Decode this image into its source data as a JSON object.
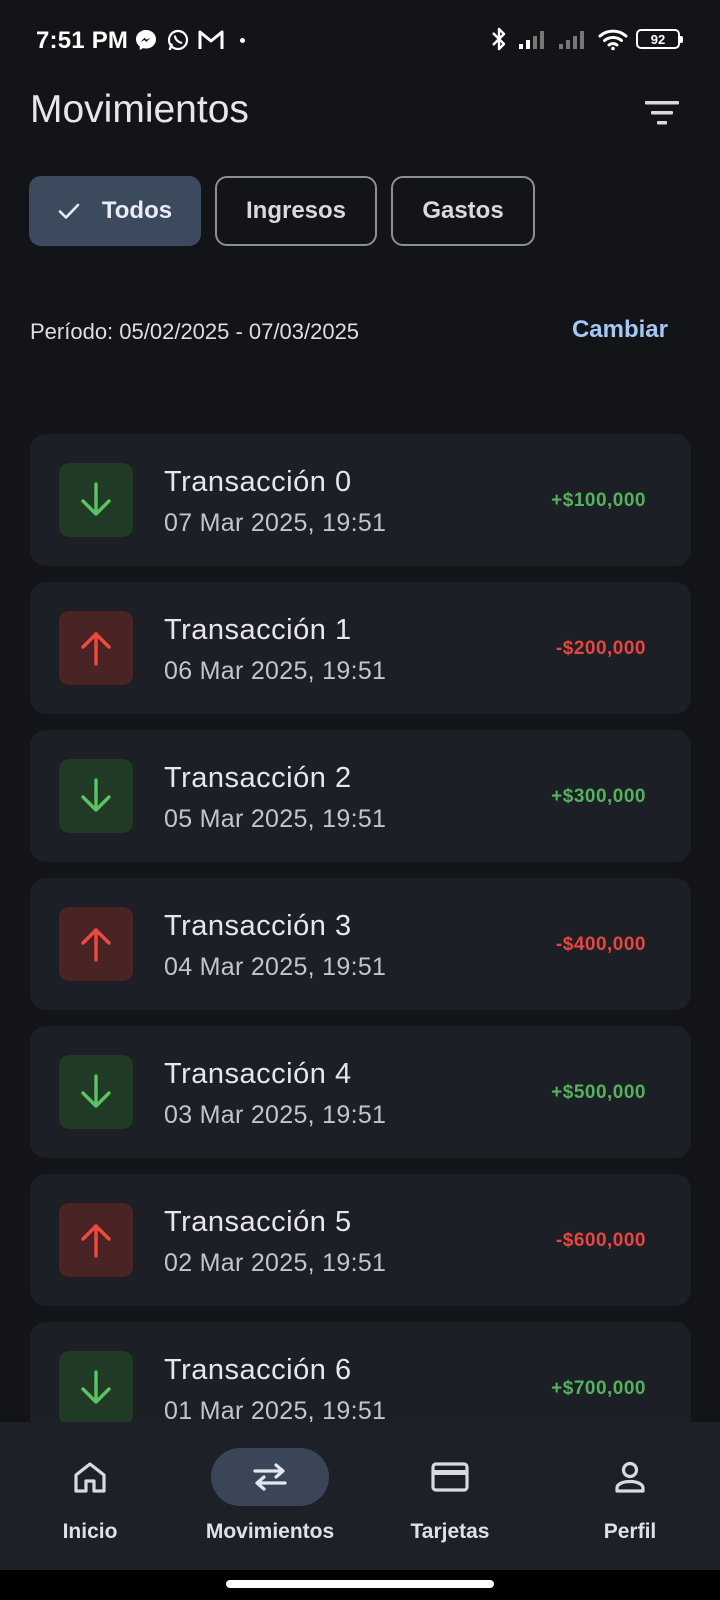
{
  "status_bar": {
    "time": "7:51 PM",
    "battery": "92",
    "icons": [
      "messenger-icon",
      "whatsapp-icon",
      "gmail-icon",
      "bluetooth-icon",
      "signal-icon",
      "wifi-icon",
      "battery-icon"
    ]
  },
  "header": {
    "title": "Movimientos",
    "filter_icon": "filter-icon"
  },
  "chips": [
    {
      "label": "Todos",
      "selected": true
    },
    {
      "label": "Ingresos",
      "selected": false
    },
    {
      "label": "Gastos",
      "selected": false
    }
  ],
  "period": {
    "text": "Período: 05/02/2025 - 07/03/2025",
    "change_label": "Cambiar"
  },
  "transactions": [
    {
      "title": "Transacción 0",
      "date": "07 Mar 2025, 19:51",
      "amount": "+$100,000",
      "type": "income"
    },
    {
      "title": "Transacción 1",
      "date": "06 Mar 2025, 19:51",
      "amount": "-$200,000",
      "type": "expense"
    },
    {
      "title": "Transacción 2",
      "date": "05 Mar 2025, 19:51",
      "amount": "+$300,000",
      "type": "income"
    },
    {
      "title": "Transacción 3",
      "date": "04 Mar 2025, 19:51",
      "amount": "-$400,000",
      "type": "expense"
    },
    {
      "title": "Transacción 4",
      "date": "03 Mar 2025, 19:51",
      "amount": "+$500,000",
      "type": "income"
    },
    {
      "title": "Transacción 5",
      "date": "02 Mar 2025, 19:51",
      "amount": "-$600,000",
      "type": "expense"
    },
    {
      "title": "Transacción 6",
      "date": "01 Mar 2025, 19:51",
      "amount": "+$700,000",
      "type": "income"
    }
  ],
  "bottom_nav": [
    {
      "label": "Inicio",
      "icon": "home-icon",
      "active": false
    },
    {
      "label": "Movimientos",
      "icon": "swap-icon",
      "active": true
    },
    {
      "label": "Tarjetas",
      "icon": "credit-card-icon",
      "active": false
    },
    {
      "label": "Perfil",
      "icon": "person-icon",
      "active": false
    }
  ],
  "colors": {
    "background": "#121418",
    "card": "#1c1f25",
    "income": "#55b25c",
    "expense": "#e7463f",
    "accent": "#a5c8f3",
    "selected_chip": "#3c4a5e"
  }
}
